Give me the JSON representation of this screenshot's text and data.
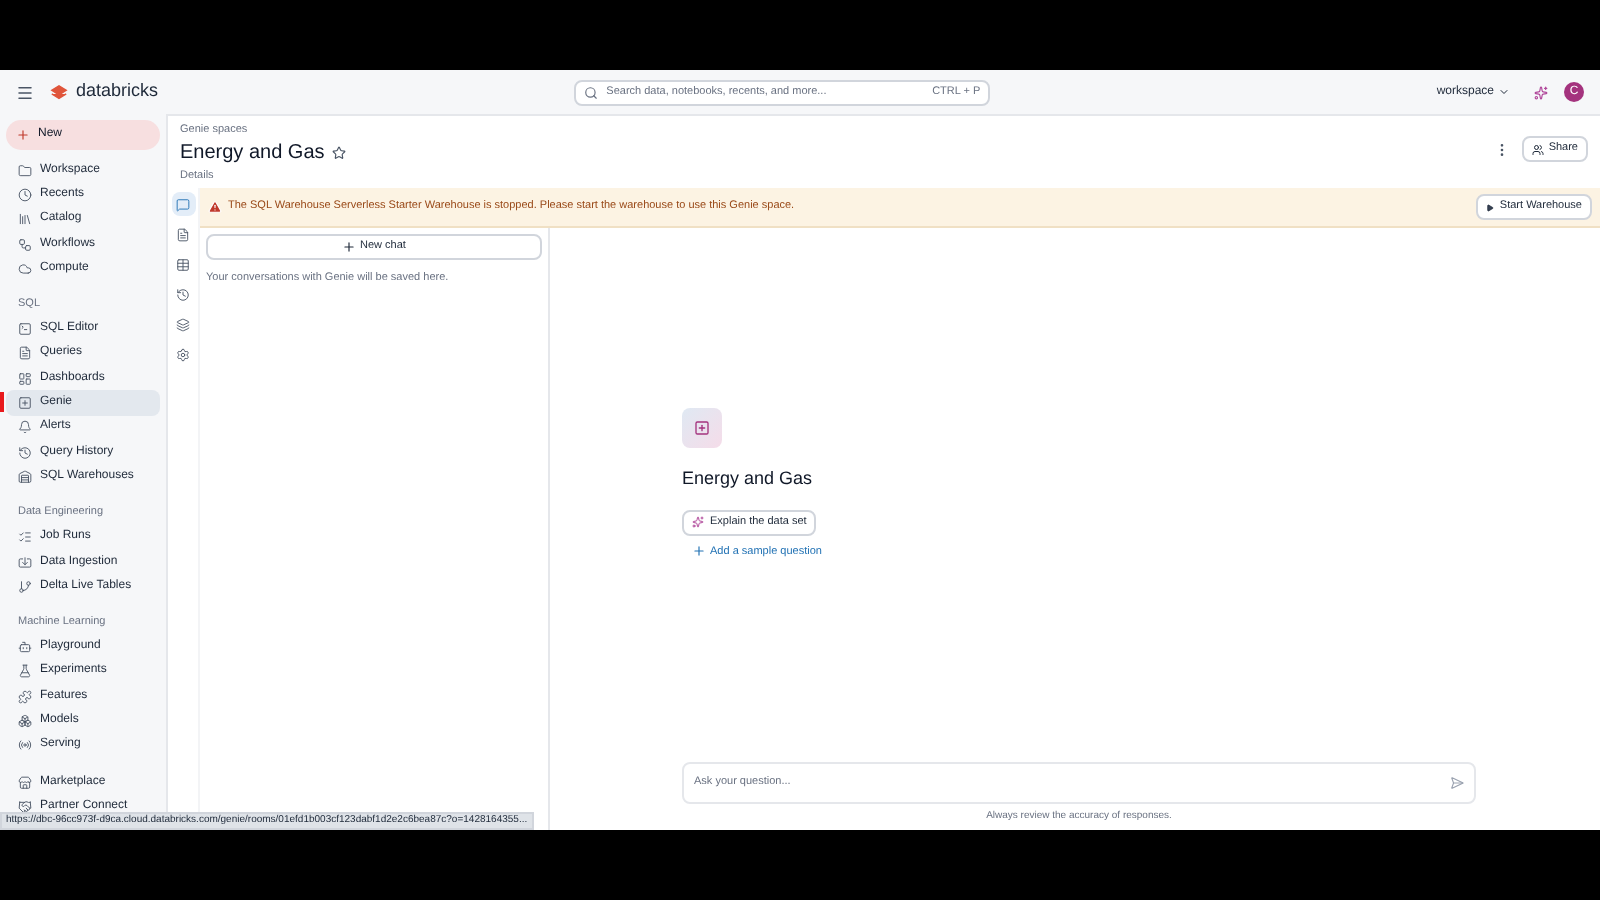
{
  "header": {
    "brand": "databricks",
    "search": {
      "placeholder": "Search data, notebooks, recents, and more...",
      "shortcut": "CTRL + P"
    },
    "workspace": "workspace",
    "avatar": "C"
  },
  "sidebar": {
    "new_button": "New",
    "sections": [
      {
        "items": [
          {
            "label": "Workspace",
            "selected": false
          },
          {
            "label": "Recents",
            "selected": false
          },
          {
            "label": "Catalog",
            "selected": false
          },
          {
            "label": "Workflows",
            "selected": false
          },
          {
            "label": "Compute",
            "selected": false
          }
        ]
      },
      {
        "heading": "SQL",
        "items": [
          {
            "label": "SQL Editor",
            "selected": false
          },
          {
            "label": "Queries",
            "selected": false
          },
          {
            "label": "Dashboards",
            "selected": false
          },
          {
            "label": "Genie",
            "selected": true
          },
          {
            "label": "Alerts",
            "selected": false
          },
          {
            "label": "Query History",
            "selected": false
          },
          {
            "label": "SQL Warehouses",
            "selected": false
          }
        ]
      },
      {
        "heading": "Data Engineering",
        "items": [
          {
            "label": "Job Runs",
            "selected": false
          },
          {
            "label": "Data Ingestion",
            "selected": false
          },
          {
            "label": "Delta Live Tables",
            "selected": false
          }
        ]
      },
      {
        "heading": "Machine Learning",
        "items": [
          {
            "label": "Playground",
            "selected": false
          },
          {
            "label": "Experiments",
            "selected": false
          },
          {
            "label": "Features",
            "selected": false
          },
          {
            "label": "Models",
            "selected": false
          },
          {
            "label": "Serving",
            "selected": false
          }
        ]
      },
      {
        "items": [
          {
            "label": "Marketplace",
            "selected": false
          },
          {
            "label": "Partner Connect",
            "selected": false
          }
        ]
      }
    ]
  },
  "page": {
    "breadcrumb": "Genie spaces",
    "title": "Energy and Gas",
    "details_link": "Details",
    "share_button": "Share"
  },
  "banner": {
    "message": "The SQL Warehouse Serverless Starter Warehouse is stopped. Please start the warehouse to use this Genie space.",
    "button": "Start Warehouse"
  },
  "rail": [
    {
      "selected": true
    },
    {
      "selected": false
    },
    {
      "selected": false
    },
    {
      "selected": false
    },
    {
      "selected": false
    },
    {
      "selected": false
    }
  ],
  "chat_panel": {
    "new_chat": "New chat",
    "hint": "Your conversations with Genie will be saved here."
  },
  "main": {
    "title": "Energy and Gas",
    "explain_button": "Explain the data set",
    "add_sample": "Add a sample question",
    "input": {
      "placeholder": "Ask your question..."
    },
    "disclaimer": "Always review the accuracy of responses."
  },
  "status_url": "https://dbc-96cc973f-d9ca.cloud.databricks.com/genie/rooms/01efd1b003cf123dabf1d2e2c6bea87c?o=1428164355..."
}
